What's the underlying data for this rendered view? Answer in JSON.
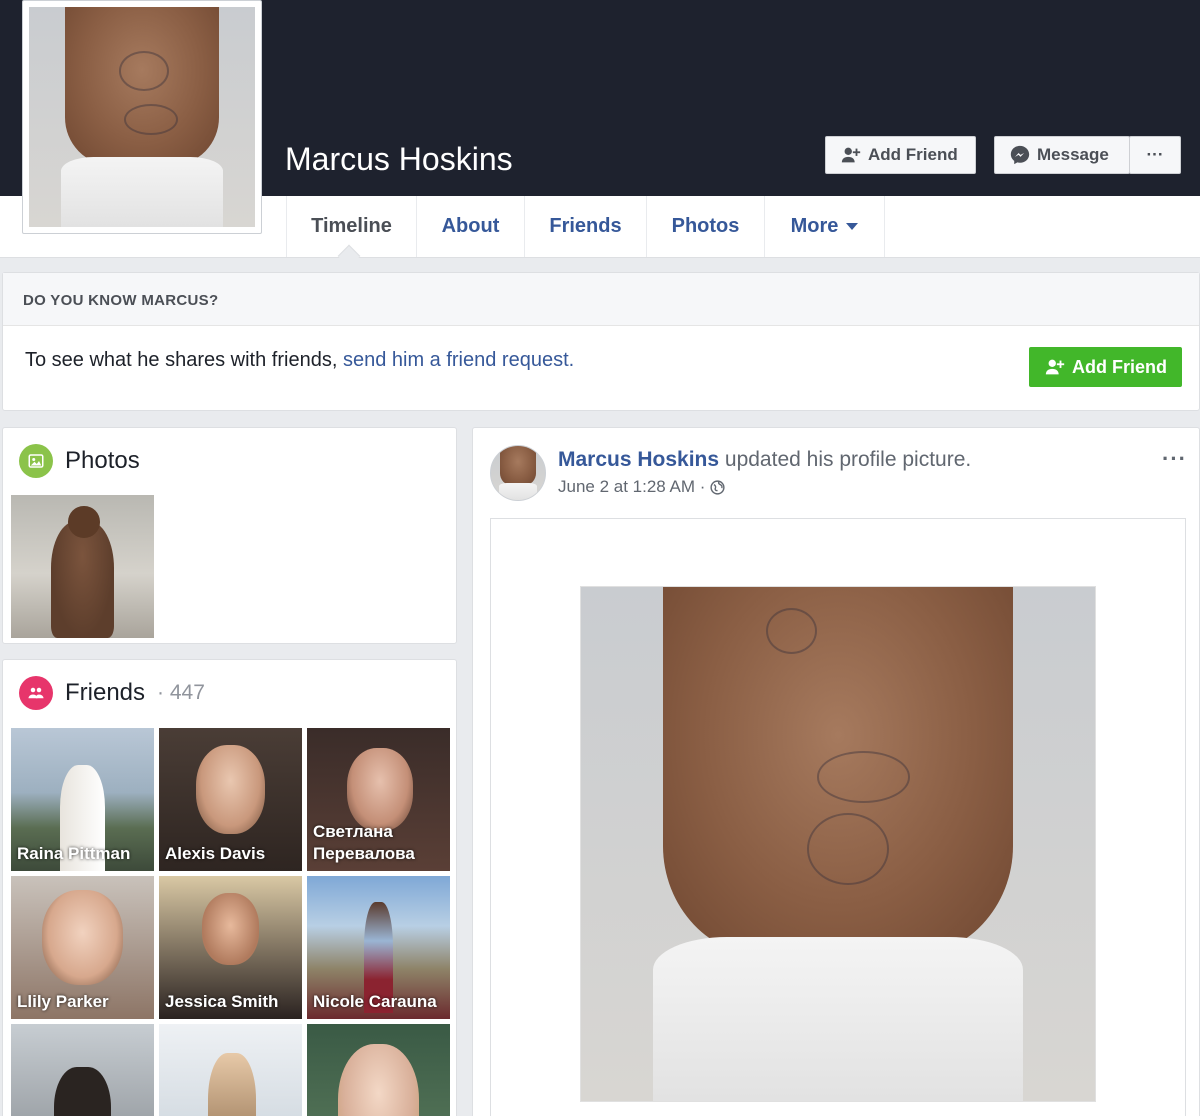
{
  "profile": {
    "name": "Marcus Hoskins"
  },
  "header_buttons": {
    "add_friend": "Add Friend",
    "message": "Message",
    "more": "···"
  },
  "tabs": [
    {
      "label": "Timeline",
      "active": true
    },
    {
      "label": "About"
    },
    {
      "label": "Friends"
    },
    {
      "label": "Photos"
    },
    {
      "label": "More"
    }
  ],
  "know_box": {
    "heading": "DO YOU KNOW MARCUS?",
    "text": "To see what he shares with friends, ",
    "link": "send him a friend request.",
    "button": "Add Friend"
  },
  "photos_card": {
    "title": "Photos"
  },
  "friends_card": {
    "title": "Friends",
    "count": "· 447",
    "friends": [
      {
        "name": "Raina Pittman"
      },
      {
        "name": "Alexis Davis"
      },
      {
        "name": "Светлана Перевалова"
      },
      {
        "name": "Llily Parker"
      },
      {
        "name": "Jessica Smith"
      },
      {
        "name": "Nicole Carauna"
      },
      {
        "name": ""
      },
      {
        "name": ""
      },
      {
        "name": ""
      }
    ]
  },
  "post": {
    "author": "Marcus Hoskins",
    "action": " updated his profile picture.",
    "date": "June 2 at 1:28 AM ·",
    "menu": "···"
  },
  "colors": {
    "cover": "#1e222e",
    "link": "#365899",
    "green": "#42b72a",
    "badge_photos": "#8bc34a",
    "badge_friends": "#e7356b"
  },
  "icons": [
    "add-friend-icon",
    "messenger-icon",
    "photos-icon",
    "friends-icon",
    "globe-icon",
    "caret-down-icon"
  ]
}
